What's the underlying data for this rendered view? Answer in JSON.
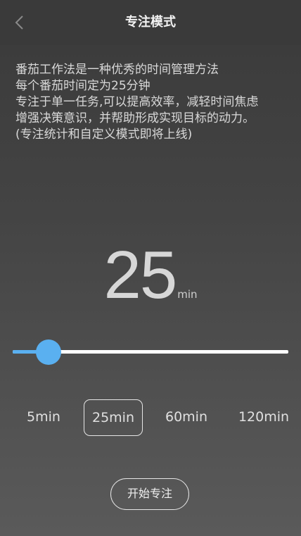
{
  "header": {
    "title": "专注模式",
    "back_icon": "chevron-left-icon"
  },
  "description": {
    "lines": [
      "番茄工作法是一种优秀的时间管理方法",
      "每个番茄时间定为25分钟",
      "专注于单一任务,可以提高效率，减轻时间焦虑",
      "增强决策意识，并帮助形成实现目标的动力。",
      "(专注统计和自定义模式即将上线)"
    ]
  },
  "timer": {
    "value": "25",
    "unit": "min"
  },
  "slider": {
    "value_minutes": 25,
    "fraction": 0.13,
    "accent_color": "#5ab0f0"
  },
  "presets": {
    "options": [
      "5min",
      "25min",
      "60min",
      "120min"
    ],
    "selected": "25min"
  },
  "actions": {
    "start_label": "开始专注"
  }
}
